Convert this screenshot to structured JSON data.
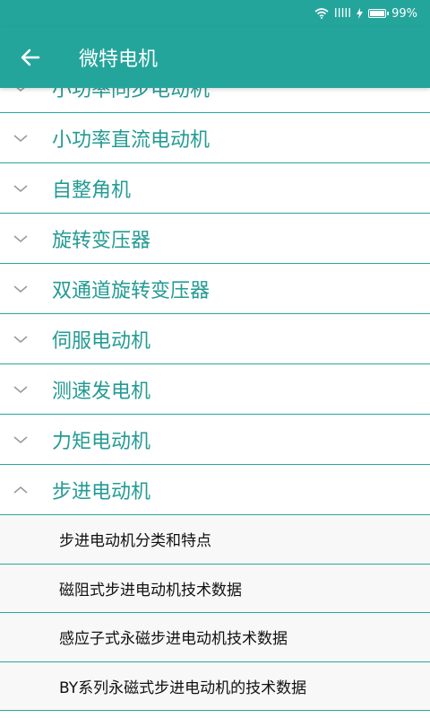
{
  "status_bar": {
    "signal": "IIIII",
    "battery_percent": "99%"
  },
  "app_bar": {
    "title": "微特电机",
    "back_icon": "arrow-left-icon"
  },
  "groups": [
    {
      "label": "小功率同步电动机",
      "expanded": false
    },
    {
      "label": "小功率直流电动机",
      "expanded": false
    },
    {
      "label": "自整角机",
      "expanded": false
    },
    {
      "label": "旋转变压器",
      "expanded": false
    },
    {
      "label": "双通道旋转变压器",
      "expanded": false
    },
    {
      "label": "伺服电动机",
      "expanded": false
    },
    {
      "label": "测速发电机",
      "expanded": false
    },
    {
      "label": "力矩电动机",
      "expanded": false
    },
    {
      "label": "步进电动机",
      "expanded": true
    }
  ],
  "children": [
    "步进电动机分类和特点",
    "磁阻式步进电动机技术数据",
    "感应子式永磁步进电动机技术数据",
    "BY系列永磁式步进电动机的技术数据"
  ],
  "colors": {
    "accent": "#24a59c",
    "label": "#249b93",
    "divider": "#2aa59f"
  }
}
